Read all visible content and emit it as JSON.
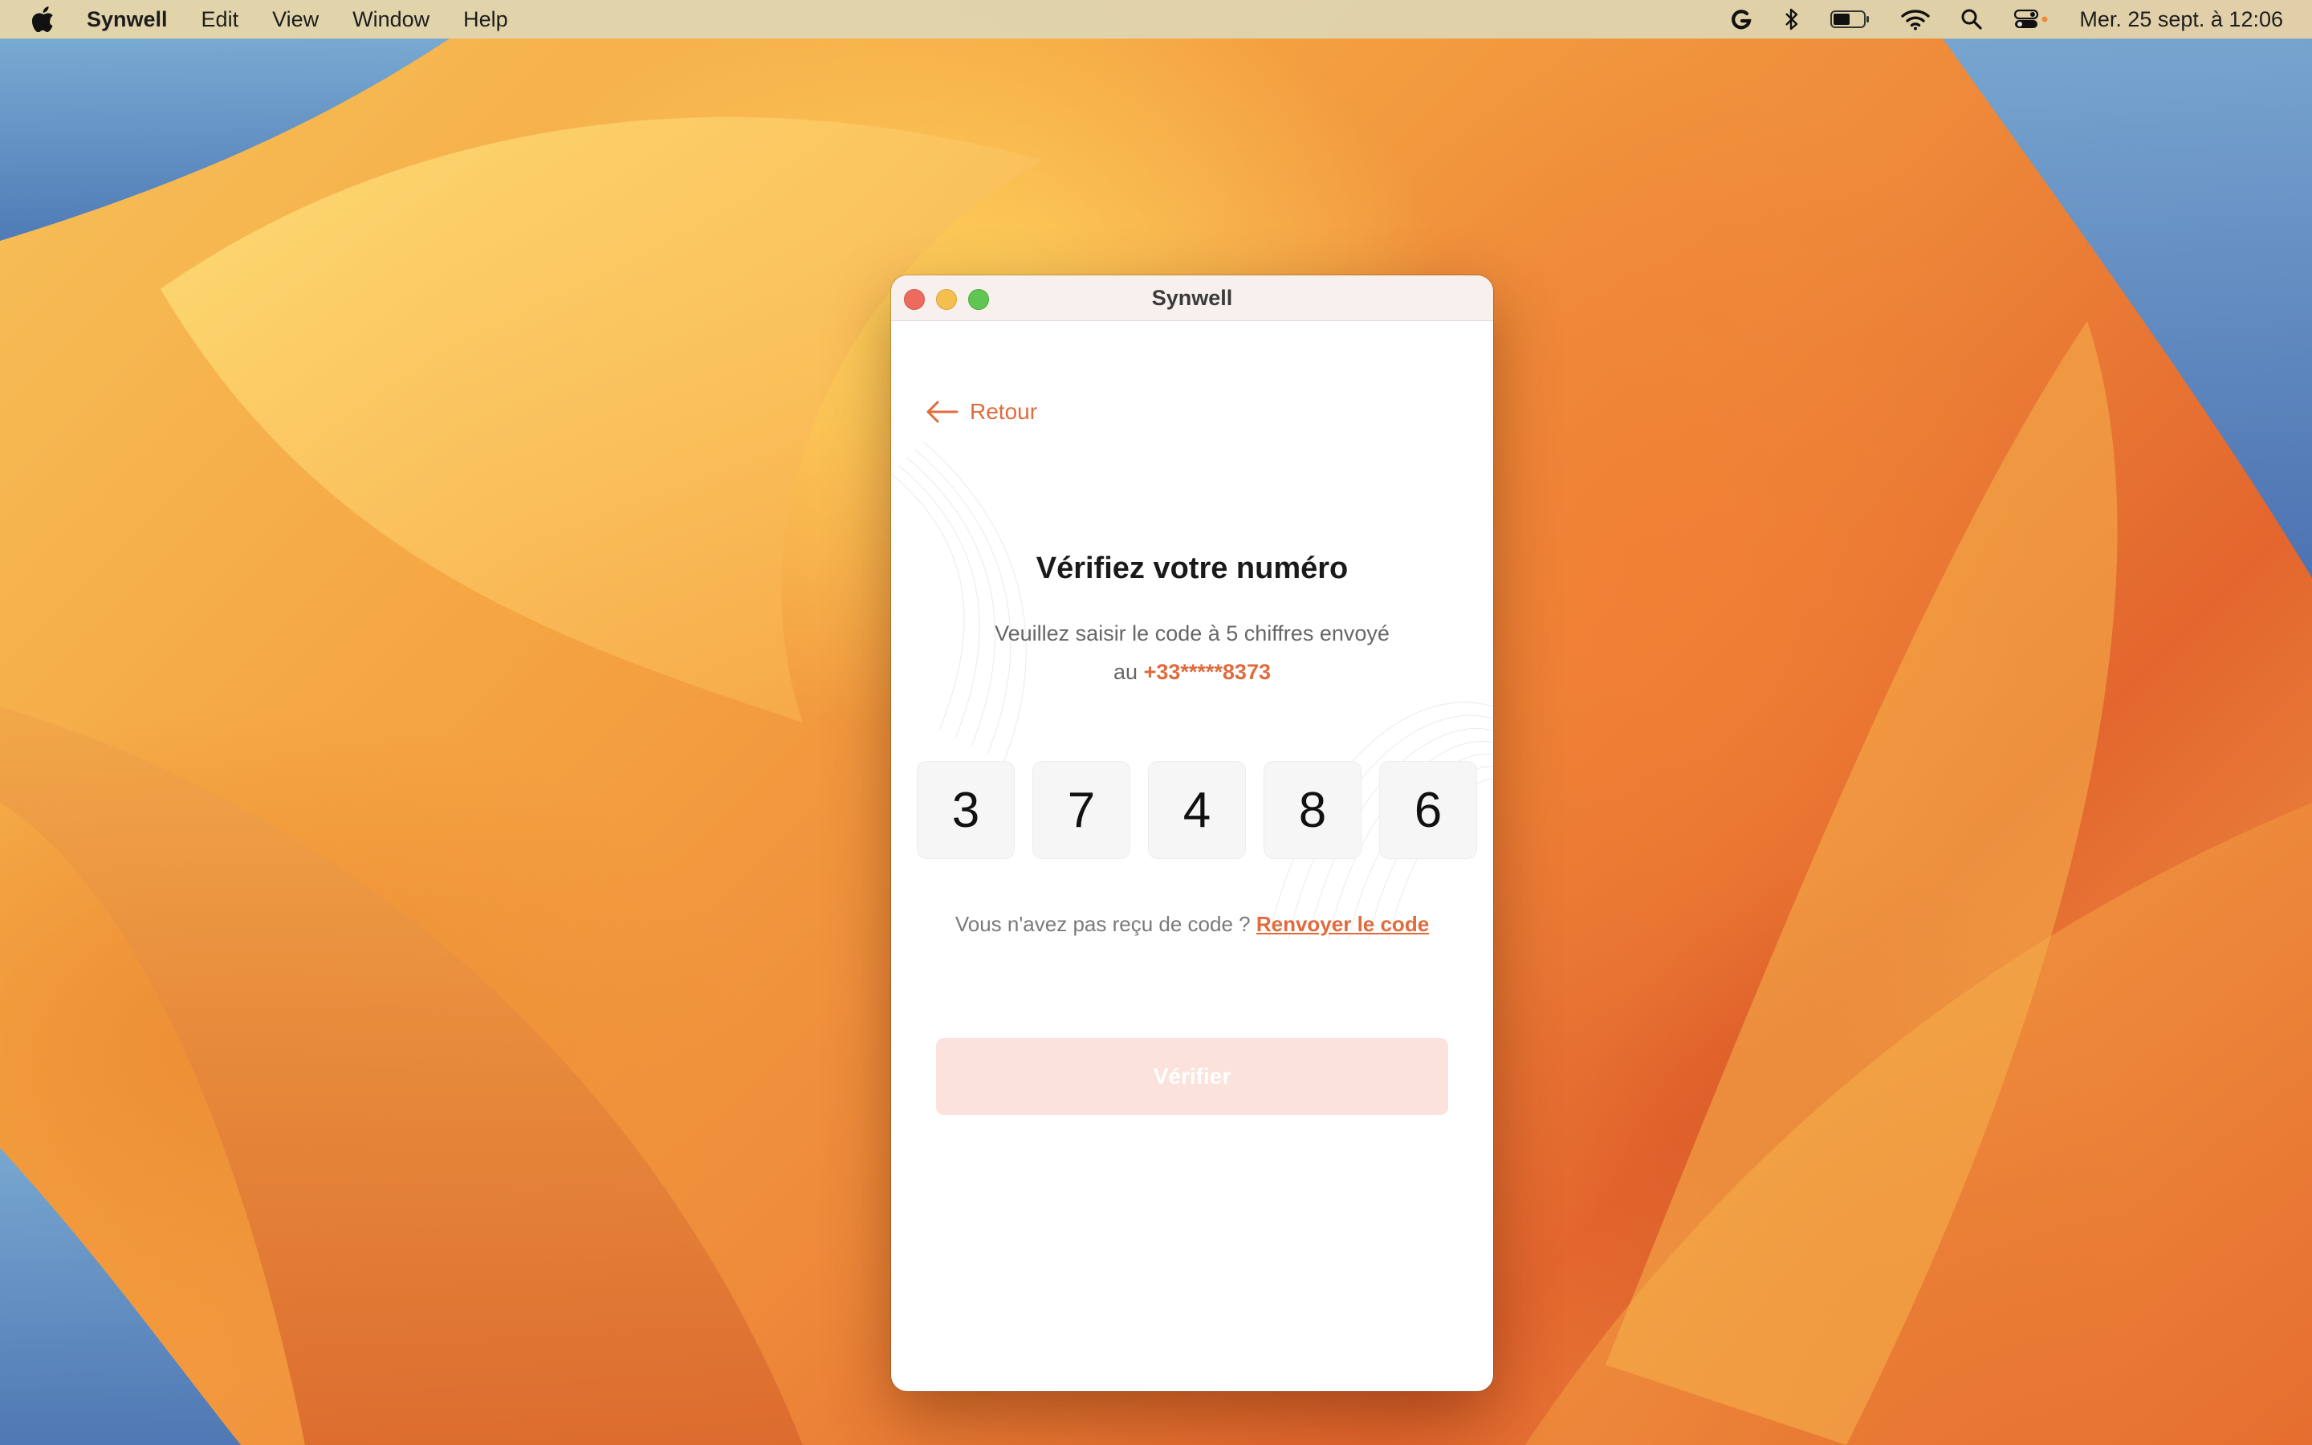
{
  "menubar": {
    "app_name": "Synwell",
    "menus": [
      "Edit",
      "View",
      "Window",
      "Help"
    ],
    "status_icons": [
      "grammarly-icon",
      "bluetooth-icon",
      "battery-icon",
      "wifi-icon",
      "spotlight-search-icon",
      "control-center-icon"
    ],
    "clock": "Mer. 25 sept. à 12:06"
  },
  "window": {
    "title": "Synwell",
    "back_label": "Retour",
    "heading": "Vérifiez votre numéro",
    "subtitle_line1": "Veuillez saisir le code à 5 chiffres envoyé",
    "subtitle_prefix": "au",
    "phone_number": "+33*****8373",
    "code_digits": [
      "3",
      "7",
      "4",
      "8",
      "6"
    ],
    "resend_prompt": "Vous n'avez pas reçu de code ?",
    "resend_link": "Renvoyer le code",
    "verify_button": "Vérifier"
  },
  "colors": {
    "accent": "#e06b3c",
    "button_disabled_bg": "#fbe2dc"
  }
}
